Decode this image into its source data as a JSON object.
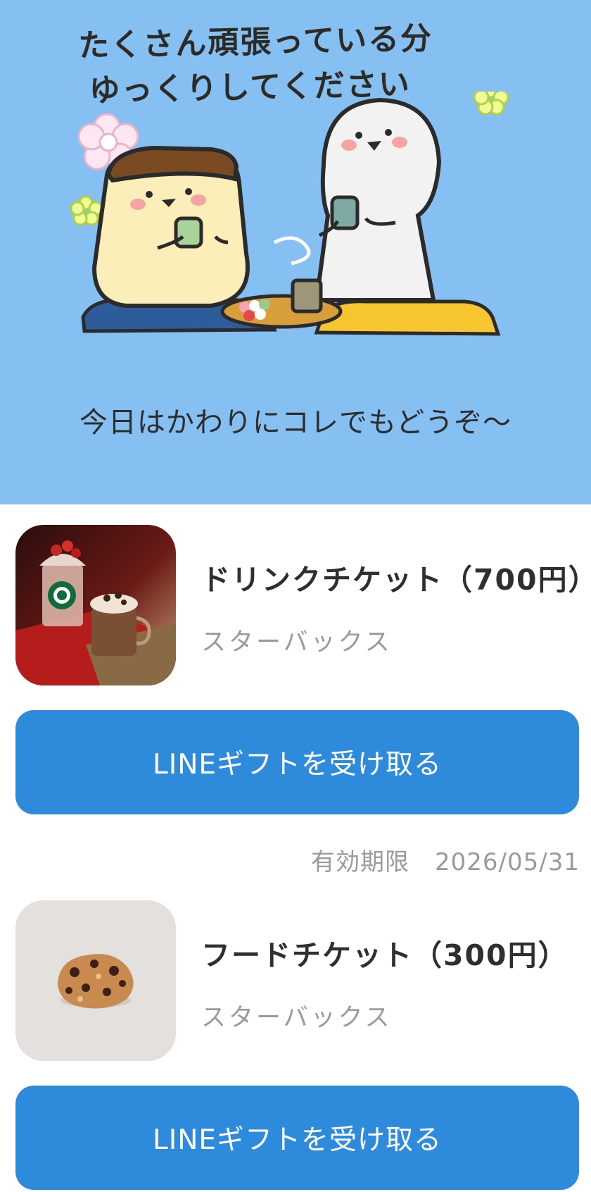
{
  "hero": {
    "title_line1": "たくさん頑張っている分",
    "title_line2": "ゆっくりしてください",
    "caption": "今日はかわりにコレでもどうぞ〜",
    "background_color": "#86BFF2",
    "illustration_icon": "two-characters-drinking-tea-illustration"
  },
  "gifts": [
    {
      "name": "ドリンクチケット（700円）",
      "brand": "スターバックス",
      "thumbnail_icon": "starbucks-drinks-image",
      "button_label": "LINEギフトを受け取る"
    },
    {
      "name": "フードチケット（300円）",
      "brand": "スターバックス",
      "thumbnail_icon": "cookie-image",
      "button_label": "LINEギフトを受け取る"
    }
  ],
  "expiry": {
    "label": "有効期限",
    "date": "2026/05/31"
  },
  "colors": {
    "button": "#2E8BDB",
    "button_text": "#FFFFFF",
    "muted_text": "#9A9A9A"
  }
}
